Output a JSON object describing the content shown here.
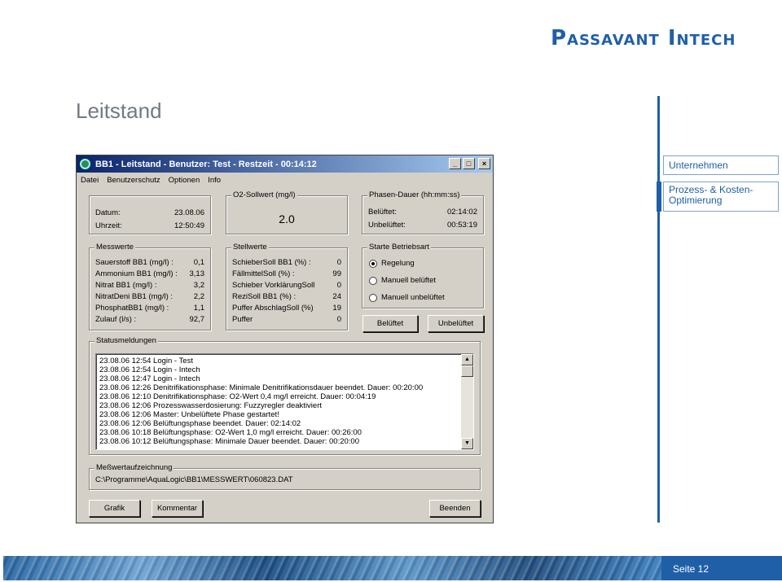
{
  "slide": {
    "logo": "Passavant Intech",
    "title": "Leitstand",
    "nav": [
      "Unternehmen",
      "Prozess- & Kosten-Optimierung"
    ],
    "page_label": "Seite 12"
  },
  "window": {
    "title": "BB1 - Leitstand -  Benutzer: Test  - Restzeit - 00:14:12",
    "menu": [
      "Datei",
      "Benutzerschutz",
      "Optionen",
      "Info"
    ],
    "date_group": {
      "rows": [
        {
          "label": "Datum:",
          "value": "23.08.06"
        },
        {
          "label": "Uhrzeit:",
          "value": "12:50:49"
        }
      ]
    },
    "o2_group": {
      "title": "O2-Sollwert (mg/l)",
      "value": "2.0"
    },
    "phase_group": {
      "title": "Phasen-Dauer (hh:mm:ss)",
      "rows": [
        {
          "label": "Belüftet:",
          "value": "02:14:02"
        },
        {
          "label": "Unbelüftet:",
          "value": "00:53:19"
        }
      ]
    },
    "messwerte": {
      "title": "Messwerte",
      "rows": [
        {
          "label": "Sauerstoff BB1 (mg/l) :",
          "value": "0,1"
        },
        {
          "label": "Ammonium BB1 (mg/l) :",
          "value": "3,13"
        },
        {
          "label": "Nitrat BB1 (mg/l) :",
          "value": "3,2"
        },
        {
          "label": "NitratDeni BB1 (mg/l) :",
          "value": "2,2"
        },
        {
          "label": "PhosphatBB1 (mg/l) :",
          "value": "1,1"
        },
        {
          "label": "Zulauf (l/s) :",
          "value": "92,7"
        }
      ]
    },
    "stellwerte": {
      "title": "Stellwerte",
      "rows": [
        {
          "label": "SchieberSoll BB1 (%) :",
          "value": "0"
        },
        {
          "label": "FällmittelSoll (%) :",
          "value": "99"
        },
        {
          "label": "Schieber VorklärungSoll",
          "value": "0"
        },
        {
          "label": "ReziSoll BB1 (%) :",
          "value": "24"
        },
        {
          "label": "Puffer AbschlagSoll (%)",
          "value": "19"
        },
        {
          "label": "Puffer",
          "value": "0"
        }
      ]
    },
    "betriebsart": {
      "title": "Starte Betriebsart",
      "options": [
        "Regelung",
        "Manuell belüftet",
        "Manuell unbelüftet"
      ],
      "selected": "Regelung"
    },
    "mode_buttons": [
      "Belüftet",
      "Unbelüftet"
    ],
    "status": {
      "title": "Statusmeldungen",
      "lines": [
        "23.08.06 12:54 Login - Test",
        "23.08.06 12:54 Login - Intech",
        "23.08.06 12:47 Login - Intech",
        "23.08.06 12:26 Denitrifikationsphase: Minimale Denitrifikationsdauer beendet. Dauer: 00:20:00",
        "23.08.06 12:10 Denitrifikationsphase: O2-Wert 0,4 mg/l erreicht. Dauer: 00:04:19",
        "23.08.06 12:06 Prozesswasserdosierung: Fuzzyregler deaktiviert",
        "23.08.06 12:06 Master: Unbelüftete Phase gestartet!",
        "23.08.06 12:06 Belüftungsphase beendet. Dauer: 02:14:02",
        "23.08.06 10:18 Belüftungsphase: O2-Wert 1,0 mg/l erreicht. Dauer: 00:26:00",
        "23.08.06 10:12 Belüftungsphase: Minimale Dauer beendet. Dauer: 00:20:00"
      ]
    },
    "recording": {
      "title": "Meßwertaufzeichnung",
      "path": "C:\\Programme\\AquaLogic\\BB1\\MESSWERT\\060823.DAT"
    },
    "bottom_buttons": [
      "Grafik",
      "Kommentar",
      "Beenden"
    ]
  }
}
